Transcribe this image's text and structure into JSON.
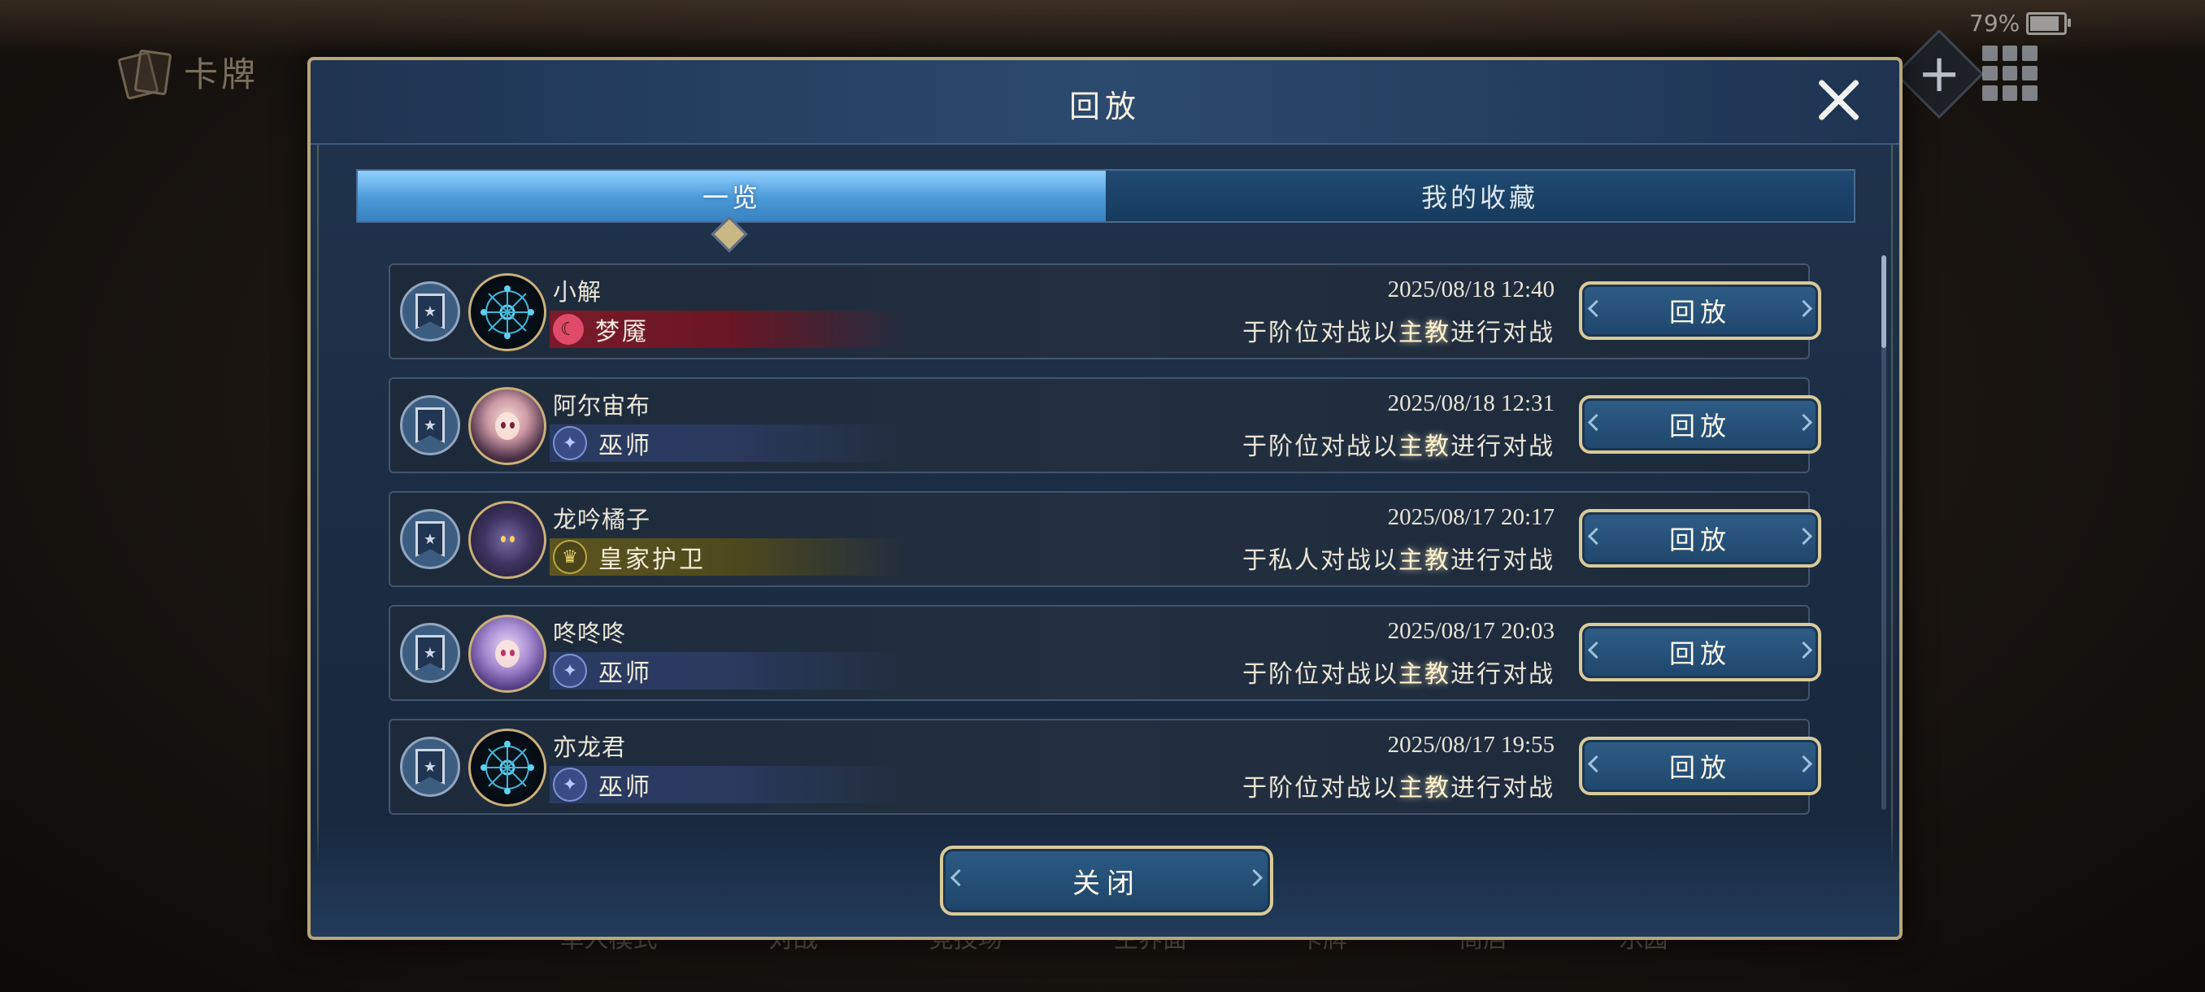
{
  "status": {
    "battery_text": "79%"
  },
  "background": {
    "section_title": "卡牌",
    "bottom_nav": [
      "单人模式",
      "对战",
      "竞技场",
      "主界面",
      "卡牌",
      "商店",
      "乐园"
    ]
  },
  "dialog": {
    "title": "回放",
    "tabs": [
      {
        "label": "一览",
        "active": true
      },
      {
        "label": "我的收藏",
        "active": false
      }
    ],
    "replays": [
      {
        "player": "小解",
        "class": "梦魇",
        "class_color": "#7a1a2a",
        "avatar": "emblem",
        "datetime": "2025/08/18  12:40",
        "mode_prefix": "于阶位对战以",
        "role": "主教",
        "mode_suffix": "进行对战",
        "button": "回放"
      },
      {
        "player": "阿尔宙布",
        "class": "巫师",
        "class_color": "#2a3b63",
        "avatar": "girl-red",
        "datetime": "2025/08/18  12:31",
        "mode_prefix": "于阶位对战以",
        "role": "主教",
        "mode_suffix": "进行对战",
        "button": "回放"
      },
      {
        "player": "龙吟橘子",
        "class": "皇家护卫",
        "class_color": "#5c5520",
        "avatar": "monster",
        "datetime": "2025/08/17  20:17",
        "mode_prefix": "于私人对战以",
        "role": "主教",
        "mode_suffix": "进行对战",
        "button": "回放"
      },
      {
        "player": "咚咚咚",
        "class": "巫师",
        "class_color": "#2a3b63",
        "avatar": "girl-purple",
        "datetime": "2025/08/17  20:03",
        "mode_prefix": "于阶位对战以",
        "role": "主教",
        "mode_suffix": "进行对战",
        "button": "回放"
      },
      {
        "player": "亦龙君",
        "class": "巫师",
        "class_color": "#2a3b63",
        "avatar": "emblem",
        "datetime": "2025/08/17  19:55",
        "mode_prefix": "于阶位对战以",
        "role": "主教",
        "mode_suffix": "进行对战",
        "button": "回放"
      }
    ],
    "close_label": "关闭"
  },
  "icons": {
    "favorite": "bookmark-star-icon",
    "nightmare": "nightmare-class-icon",
    "mage": "mage-class-icon",
    "royal": "royal-crown-icon",
    "close": "close-icon",
    "add": "plus-icon",
    "menu": "grid-menu-icon"
  }
}
